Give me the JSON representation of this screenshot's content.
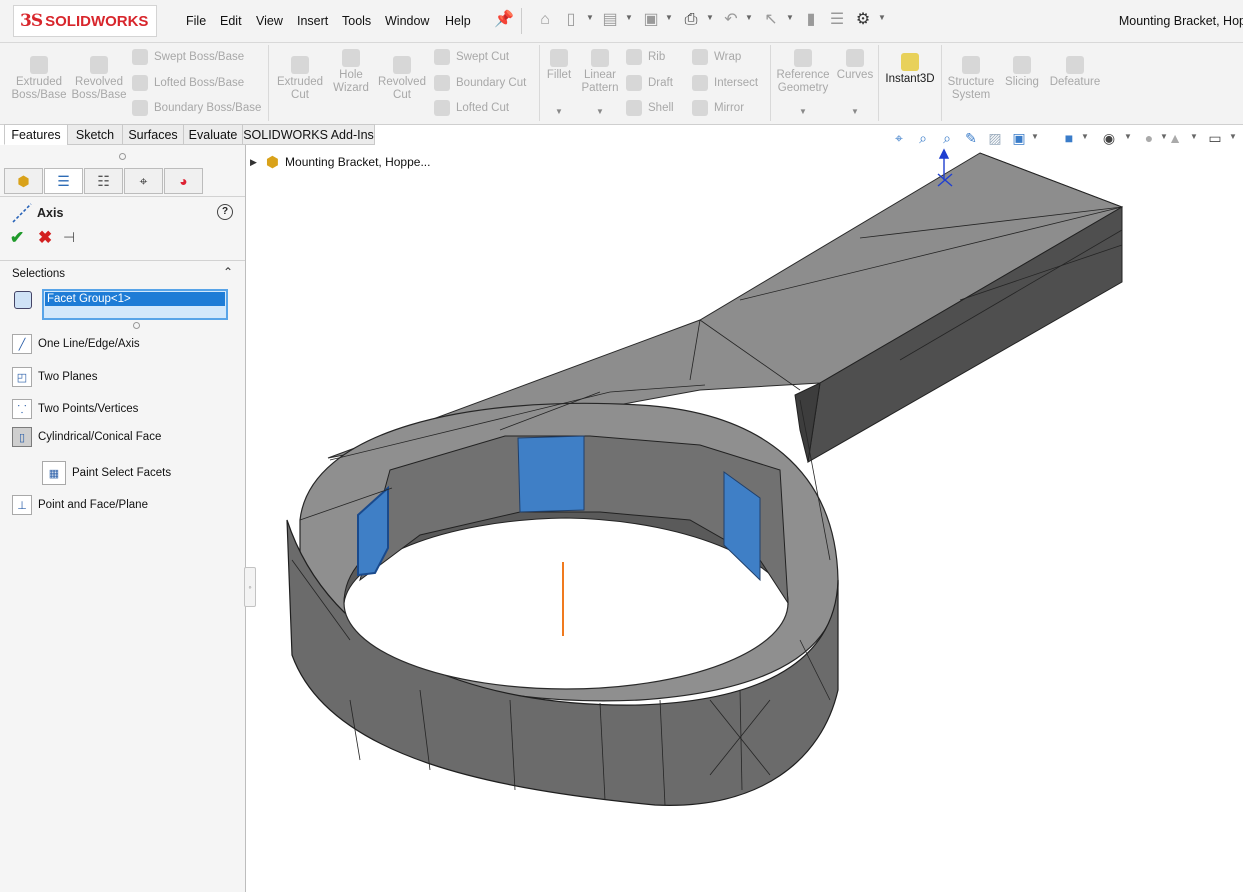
{
  "window": {
    "title": "Mounting Bracket, Hop"
  },
  "logo": {
    "mark": "3S",
    "word": "SOLIDWORKS"
  },
  "menu": [
    "File",
    "Edit",
    "View",
    "Insert",
    "Tools",
    "Window",
    "Help"
  ],
  "toolbar_icons": [
    "home-icon",
    "new-document-icon",
    "open-folder-icon",
    "save-icon",
    "print-icon",
    "undo-icon",
    "select-arrow-icon",
    "rebuild-icon",
    "file-properties-icon",
    "options-gear-icon"
  ],
  "command_manager": {
    "extruded_boss": "Extruded Boss/Base",
    "revolved_boss": "Revolved Boss/Base",
    "swept_boss": "Swept Boss/Base",
    "lofted_boss": "Lofted Boss/Base",
    "boundary_boss": "Boundary Boss/Base",
    "extruded_cut": "Extruded Cut",
    "hole_wizard": "Hole Wizard",
    "revolved_cut": "Revolved Cut",
    "swept_cut": "Swept Cut",
    "boundary_cut": "Boundary Cut",
    "lofted_cut": "Lofted Cut",
    "fillet": "Fillet",
    "linear_pattern": "Linear Pattern",
    "rib": "Rib",
    "draft": "Draft",
    "shell": "Shell",
    "wrap": "Wrap",
    "intersect": "Intersect",
    "mirror": "Mirror",
    "reference_geometry": "Reference Geometry",
    "curves": "Curves",
    "instant3d": "Instant3D",
    "structure_system": "Structure System",
    "slicing": "Slicing",
    "defeature": "Defeature"
  },
  "tabs": [
    "Features",
    "Sketch",
    "Surfaces",
    "Evaluate",
    "SOLIDWORKS Add-Ins"
  ],
  "property_manager": {
    "title": "Axis",
    "help": "?",
    "selections_label": "Selections",
    "selection_value": "Facet Group<1>",
    "options": {
      "one_line": "One Line/Edge/Axis",
      "two_planes": "Two Planes",
      "two_points": "Two Points/Vertices",
      "cyl_face": "Cylindrical/Conical Face",
      "paint_select": "Paint Select Facets",
      "point_face": "Point and Face/Plane"
    }
  },
  "tree": {
    "root_label": "Mounting Bracket, Hoppe..."
  },
  "colors": {
    "accent": "#1e7cd6",
    "model": "#8a8a8a",
    "highlight": "#3f7fc6",
    "axis_preview": "#f07a1e"
  }
}
